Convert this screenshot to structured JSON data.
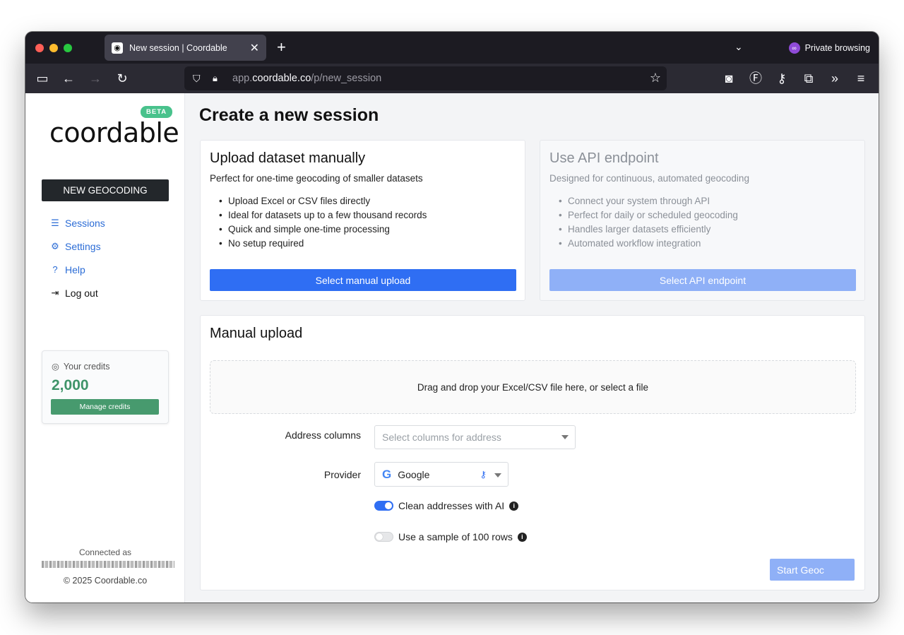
{
  "browser": {
    "tab_title": "New session | Coordable",
    "private_label": "Private browsing",
    "url_prefix": "app.",
    "url_host": "coordable.co",
    "url_path": "/p/new_session",
    "new_tab_glyph": "+",
    "tab_close_glyph": "✕"
  },
  "sidebar": {
    "logo_text": "coordable",
    "beta_badge": "BETA",
    "new_geocoding_label": "NEW GEOCODING",
    "nav": [
      {
        "label": "Sessions",
        "icon": "list-icon"
      },
      {
        "label": "Settings",
        "icon": "gear-icon"
      },
      {
        "label": "Help",
        "icon": "help-icon"
      },
      {
        "label": "Log out",
        "icon": "logout-icon"
      }
    ],
    "credits_label": "Your credits",
    "credits_value": "2,000",
    "manage_credits_label": "Manage credits",
    "connected_as": "Connected as",
    "copyright": "© 2025 Coordable.co"
  },
  "main": {
    "title": "Create a new session",
    "manual_card": {
      "title": "Upload dataset manually",
      "subtitle": "Perfect for one-time geocoding of smaller datasets",
      "features": [
        "Upload Excel or CSV files directly",
        "Ideal for datasets up to a few thousand records",
        "Quick and simple one-time processing",
        "No setup required"
      ],
      "button": "Select manual upload"
    },
    "api_card": {
      "title": "Use API endpoint",
      "subtitle": "Designed for continuous, automated geocoding",
      "features": [
        "Connect your system through API",
        "Perfect for daily or scheduled geocoding",
        "Handles larger datasets efficiently",
        "Automated workflow integration"
      ],
      "button": "Select API endpoint"
    },
    "upload": {
      "title": "Manual upload",
      "dropzone_text": "Drag and drop your Excel/CSV file here, or select a file",
      "address_label": "Address columns",
      "address_placeholder": "Select columns for address",
      "provider_label": "Provider",
      "provider_value": "Google",
      "clean_label": "Clean addresses with AI",
      "clean_enabled": true,
      "sample_label": "Use a sample of 100 rows",
      "sample_enabled": false,
      "start_button": "Start Geoc"
    }
  },
  "colors": {
    "primary": "#2f6ef3",
    "success": "#479a6e",
    "beta": "#49c28c"
  }
}
